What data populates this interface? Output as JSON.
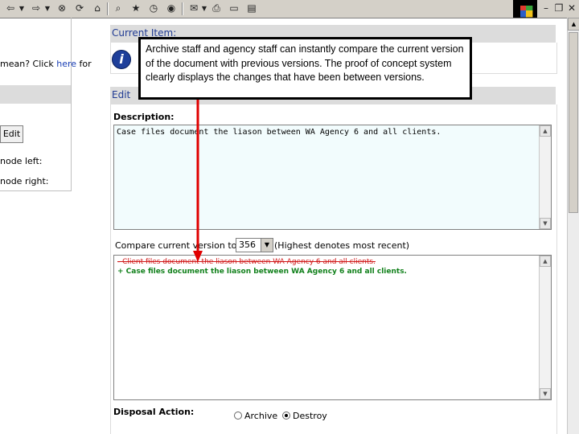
{
  "toolbar": {
    "icons": [
      "back-icon",
      "forward-icon",
      "stop-icon",
      "refresh-icon",
      "home-icon",
      "search-icon",
      "favorites-icon",
      "history-icon",
      "mail-icon",
      "print-icon",
      "edit-icon",
      "discuss-icon"
    ]
  },
  "left_panel": {
    "mean_text": "mean? Click ",
    "here_link": "here",
    "mean_suffix": " for",
    "edit_button": "Edit",
    "node_left": "node left:",
    "node_right": "node right:"
  },
  "current_item": {
    "header": "Current Item:"
  },
  "edit_section": {
    "header": "Edit",
    "description_label": "Description:",
    "description_text": "Case files document the liason between WA Agency 6 and all clients.",
    "compare_label": "Compare current version to:",
    "compare_value": "356",
    "compare_note": "(Highest denotes most recent)",
    "diff_old": "- Client files document the liason between WA Agency 6 and all clients.",
    "diff_new": "+ Case files document the liason between WA Agency 6 and all clients.",
    "disposal_label": "Disposal Action:",
    "disposal_options": [
      "Archive",
      "Destroy"
    ],
    "disposal_selected": "Destroy"
  },
  "callout": {
    "text": "Archive staff and agency staff can instantly compare the current version of the document with previous versions. The proof of concept system clearly displays the changes that have been between versions."
  },
  "colors": {
    "header_bg": "#dcdcdc",
    "header_text": "#1f3a93",
    "diff_removed": "#d01616",
    "diff_added": "#12811c",
    "arrow": "#e00000"
  }
}
